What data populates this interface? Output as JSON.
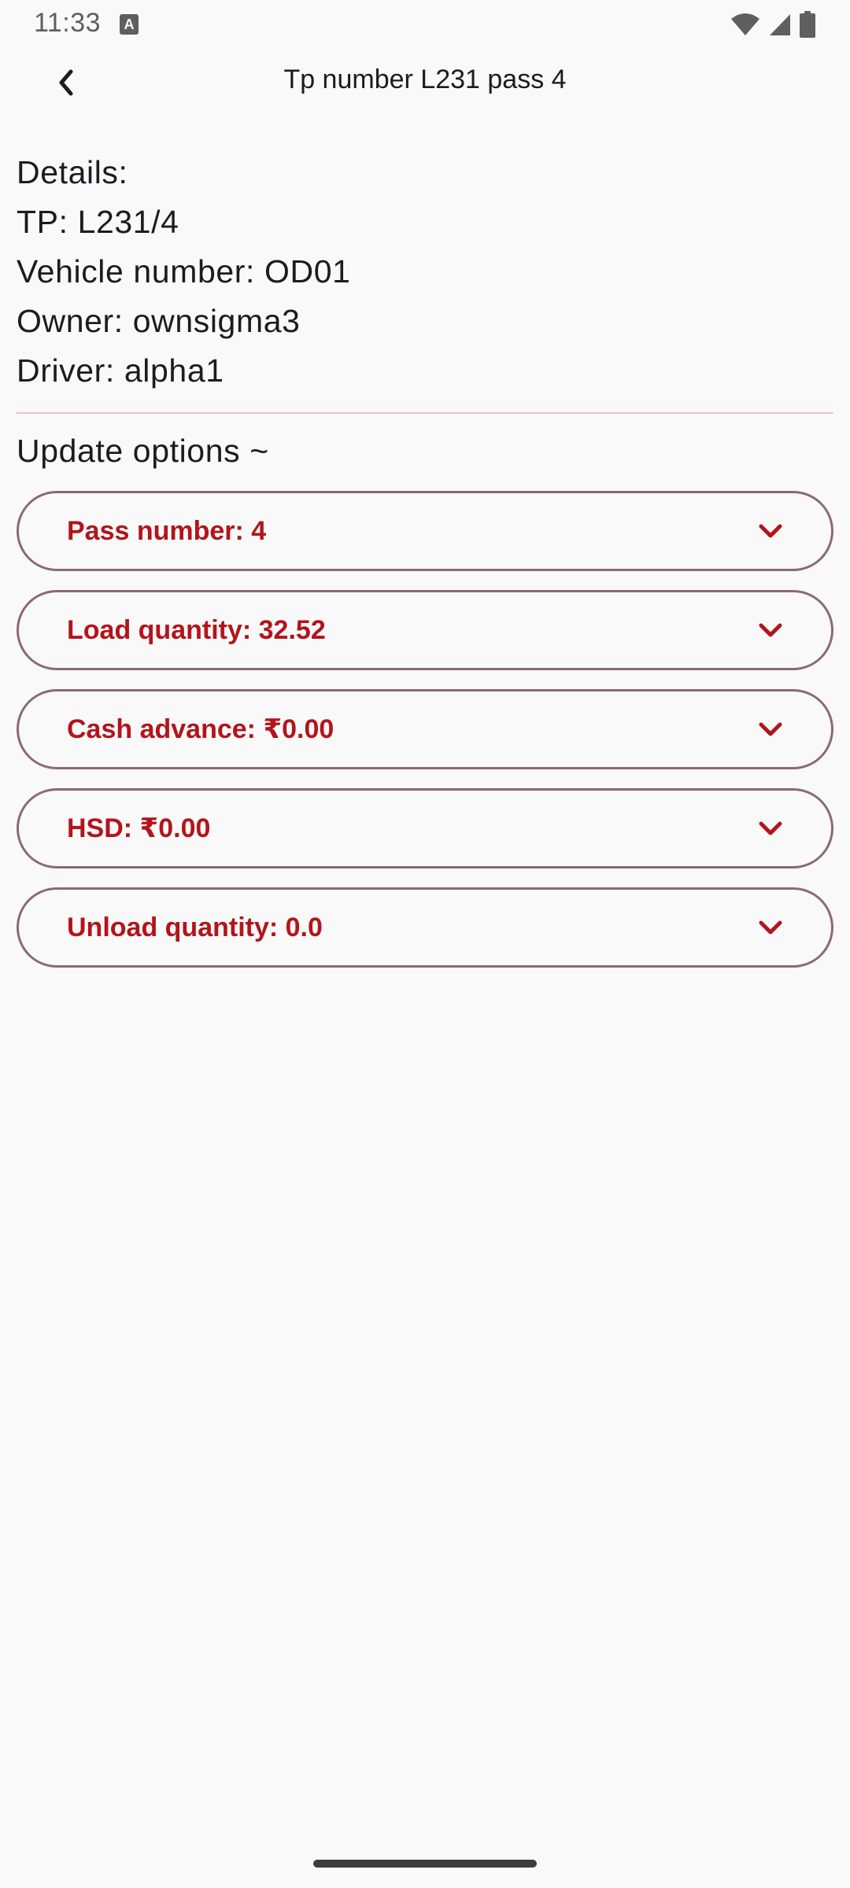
{
  "status_bar": {
    "time": "11:33",
    "notification_glyph": "A",
    "icons": [
      "wifi-icon",
      "cellular-signal-icon",
      "battery-icon"
    ]
  },
  "app_bar": {
    "title": "Tp number L231 pass 4",
    "back_icon": "chevron-left-icon"
  },
  "details": {
    "heading": "Details:",
    "tp": "TP: L231/4",
    "vehicle": "Vehicle number: OD01",
    "owner": "Owner: ownsigma3",
    "driver": "Driver: alpha1"
  },
  "update": {
    "heading": "Update options ~",
    "options": [
      {
        "label": "Pass number: 4"
      },
      {
        "label": "Load quantity: 32.52"
      },
      {
        "label": "Cash advance: ₹0.00"
      },
      {
        "label": "HSD: ₹0.00"
      },
      {
        "label": "Unload quantity: 0.0"
      }
    ]
  },
  "colors": {
    "accent": "#b3141b",
    "outline": "#8c6b6b",
    "divider": "#e8c5bf",
    "background": "#f9f9f9"
  }
}
